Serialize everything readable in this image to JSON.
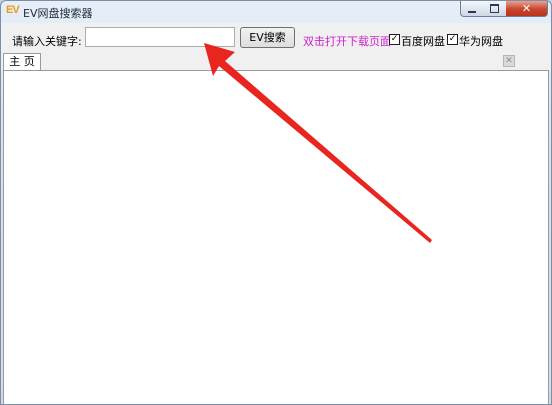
{
  "window": {
    "title": "EV网盘搜索器",
    "logo_text": "EV",
    "close_glyph": "✕"
  },
  "toolbar": {
    "keyword_label": "请输入关键字:",
    "search_input": {
      "value": "",
      "placeholder": ""
    },
    "search_button": "EV搜索",
    "hint": "双击打开下载页面",
    "checkboxes": [
      {
        "label": "百度网盘",
        "checked": true,
        "mark": "✓"
      },
      {
        "label": "华为网盘",
        "checked": true,
        "mark": "✓"
      }
    ]
  },
  "tabs": [
    {
      "label": "主 页",
      "active": true
    }
  ],
  "tab_close_glyph": "✕",
  "colors": {
    "hint": "#cc22cc",
    "logo": "#ef9a16",
    "arrow": "#e8251e",
    "close_button": "#c8442c"
  }
}
